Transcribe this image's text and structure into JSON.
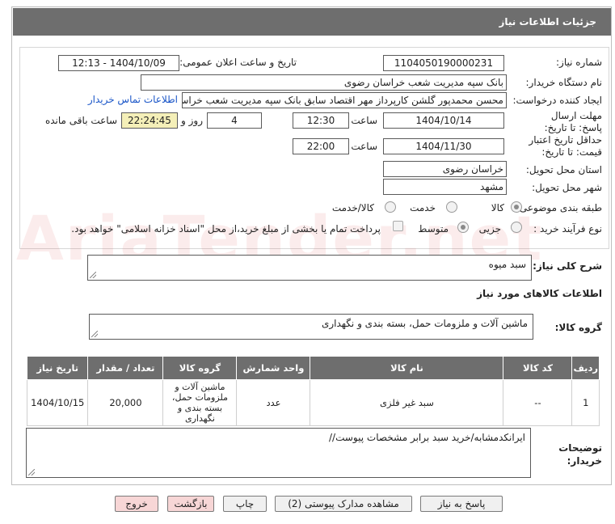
{
  "header": {
    "title": "جزئیات اطلاعات نیاز"
  },
  "form": {
    "need_number": {
      "label": "شماره نیاز:",
      "value": "1104050190000231"
    },
    "announce": {
      "label": "تاریخ و ساعت اعلان عمومی:",
      "value": "1404/10/09 - 12:13"
    },
    "buyer_org": {
      "label": "نام دستگاه خریدار:",
      "value": "بانک سپه مدیریت شعب خراسان رضوی"
    },
    "requester": {
      "label": "ایجاد کننده درخواست:",
      "value": "محسن محمدپور گلشن کارپرداز مهر اقتصاد سابق بانک سپه مدیریت شعب خراس",
      "contact_link": "اطلاعات تماس خریدار"
    },
    "reply_deadline": {
      "label": "مهلت ارسال پاسخ: تا تاریخ:",
      "date": "1404/10/14",
      "time_label": "ساعت",
      "time": "12:30",
      "days": "4",
      "days_label": "روز و",
      "remaining": "22:24:45",
      "remaining_label": "ساعت باقی مانده"
    },
    "price_validity": {
      "label": "حداقل تاریخ اعتبار قیمت: تا تاریخ:",
      "date": "1404/11/30",
      "time_label": "ساعت",
      "time": "22:00"
    },
    "province": {
      "label": "استان محل تحویل:",
      "value": "خراسان رضوی"
    },
    "city": {
      "label": "شهر محل تحویل:",
      "value": "مشهد"
    },
    "category": {
      "label": "طبقه بندی موضوعی:",
      "options": [
        "کالا",
        "خدمت",
        "کالا/خدمت"
      ],
      "selected": "کالا"
    },
    "process": {
      "label": "نوع فرآیند خرید :",
      "options": [
        "جزیی",
        "متوسط"
      ],
      "selected": "جزیی",
      "note": "پرداخت تمام یا بخشی از مبلغ خرید،از محل \"اسناد خزانه اسلامی\" خواهد بود."
    }
  },
  "summary": {
    "label": "شرح کلی نیاز:",
    "value": "سبد میوه"
  },
  "goods_info": {
    "title": "اطلاعات کالاهای مورد نیاز"
  },
  "goods_group": {
    "label": "گروه کالا:",
    "value": "ماشین آلات و ملزومات حمل، بسته بندی و نگهداری"
  },
  "table": {
    "headers": [
      "ردیف",
      "کد کالا",
      "نام کالا",
      "واحد شمارش",
      "گروه کالا",
      "تعداد / مقدار",
      "تاریخ نیاز"
    ],
    "rows": [
      [
        "1",
        "--",
        "سبد غیر فلزی",
        "عدد",
        "ماشین آلات و ملزومات حمل، بسته بندی و نگهداری",
        "20,000",
        "1404/10/15"
      ]
    ]
  },
  "buyer_notes": {
    "label": "توضیحات خریدار:",
    "value": "ایرانکدمشابه/خرید سبد برابر مشخصات پیوست//"
  },
  "buttons": {
    "reply": "پاسخ به نیاز",
    "attachments": "مشاهده مدارک پیوستی (2)",
    "print": "چاپ",
    "back": "بازگشت",
    "exit": "خروج"
  },
  "watermark": "AriaTender.net"
}
